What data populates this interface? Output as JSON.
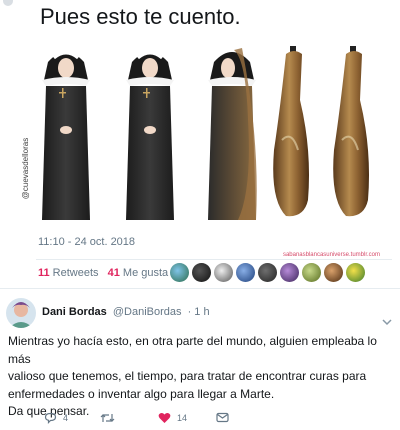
{
  "tweet": {
    "text": "Pues esto te cuento.",
    "photo_credit": "@cuevasdelloras",
    "watermark": "sabanasblancasuniverse.tumblr.com",
    "timestamp": "11:10 - 24 oct. 2018",
    "retweets_count": "11",
    "retweets_label": "Retweets",
    "likes_count": "41",
    "likes_label": "Me gusta"
  },
  "reply": {
    "name": "Dani Bordas",
    "handle": "@DaniBordas",
    "time": "· 1 h",
    "text_lines": [
      "Mientras yo hacía esto, en otra parte del mundo, alguien empleaba lo más",
      "valioso que tenemos, el tiempo, para tratar de encontrar curas para",
      "enfermedades o inventar algo para llegar a Marte.",
      "Da que pensar."
    ],
    "reply_count": "4",
    "retweet_count": "",
    "like_count": "14"
  },
  "colors": {
    "like": "#e0245e",
    "secondary_text": "#657786",
    "divider": "#e6ecf0"
  }
}
